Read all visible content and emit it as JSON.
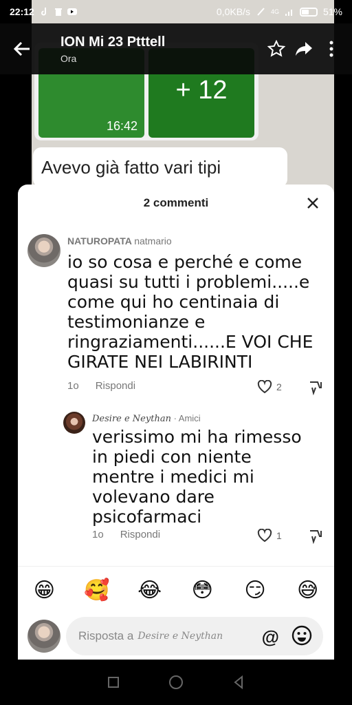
{
  "status_bar": {
    "time": "22:12",
    "network_speed": "0,0KB/s",
    "network_type": "4G",
    "battery": "51%"
  },
  "chat_header": {
    "title": "ION Mi 23 Ptttell",
    "subtitle": "Ora"
  },
  "background_chat": {
    "tile_time": "16:42",
    "tile_more": "+ 12",
    "message_text": "Avevo già fatto vari tipi"
  },
  "comments_sheet": {
    "title": "2 commenti",
    "comments": [
      {
        "author": "NATUROPATA",
        "handle": "natmario",
        "text": "io so cosa e perché e come quasi su tutti i problemi.....e come qui ho centinaia di testimonianze e ringraziamenti......E VOI CHE GIRATE NEI LABIRINTI",
        "age": "1o",
        "reply_label": "Rispondi",
        "likes": "2"
      },
      {
        "author": "Desire e Neythan",
        "tag": "· Amici",
        "text": "verissimo mi ha rimesso in piedi con niente mentre i medici mi volevano dare psicofarmaci",
        "age": "1o",
        "reply_label": "Rispondi",
        "likes": "1"
      }
    ],
    "emojis": [
      "😁",
      "🥰",
      "😂",
      "😳",
      "😏",
      "😅"
    ],
    "reply_prefix": "Risposta a",
    "reply_target": "Desire e Neythan",
    "at_symbol": "@"
  },
  "icons": {
    "back": "back-arrow-icon",
    "star": "star-icon",
    "share": "share-icon",
    "more": "more-vertical-icon",
    "close": "close-icon",
    "heart": "heart-icon",
    "dislike": "thumb-down-icon",
    "emoji_picker": "smiley-icon"
  }
}
